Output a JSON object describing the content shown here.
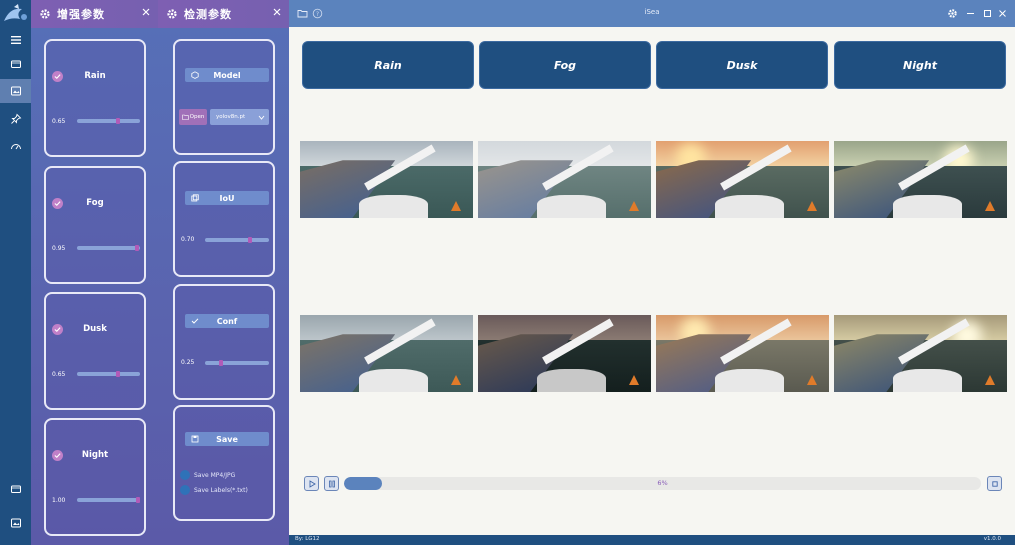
{
  "panel_enhance": {
    "title": "增强参数",
    "cards": [
      {
        "label": "Rain",
        "value": "0.65",
        "level": 0.65,
        "checked": true
      },
      {
        "label": "Fog",
        "value": "0.95",
        "level": 0.95,
        "checked": true
      },
      {
        "label": "Dusk",
        "value": "0.65",
        "level": 0.65,
        "checked": true
      },
      {
        "label": "Night",
        "value": "1.00",
        "level": 1.0,
        "checked": true
      }
    ]
  },
  "panel_detect": {
    "title": "检测参数",
    "model": {
      "label": "Model",
      "open_label": "Open",
      "selected": "yolov8n.pt"
    },
    "iou": {
      "label": "IoU",
      "value": "0.70",
      "level": 0.7
    },
    "conf": {
      "label": "Conf",
      "value": "0.25",
      "level": 0.25
    },
    "save": {
      "label": "Save",
      "options": [
        "Save MP4/JPG",
        "Save Labels(*.txt)"
      ]
    }
  },
  "window": {
    "title": "iSea"
  },
  "aug_buttons": [
    "Rain",
    "Fog",
    "Dusk",
    "Night"
  ],
  "thumbnails": {
    "row1": [
      "original-1",
      "fog",
      "dusk",
      "night"
    ],
    "row2": [
      "original-2",
      "night-dark",
      "dusk-2",
      "night-2"
    ]
  },
  "progress": {
    "percent_label": "6%",
    "fraction": 0.06
  },
  "status": {
    "left": "By: LG12",
    "right": "v1.0.0"
  },
  "colors": {
    "accent": "#5b83bd",
    "dark": "#1f4f80",
    "purple": "#7e5fb2",
    "knob": "#b25bb8"
  },
  "icons": [
    "menu-icon",
    "camera-icon",
    "image-icon",
    "pin-icon",
    "dashboard-icon",
    "folder-icon",
    "help-icon",
    "gear-icon",
    "minimize-icon",
    "maximize-icon",
    "close-icon",
    "play-icon",
    "pause-icon",
    "stop-icon"
  ]
}
